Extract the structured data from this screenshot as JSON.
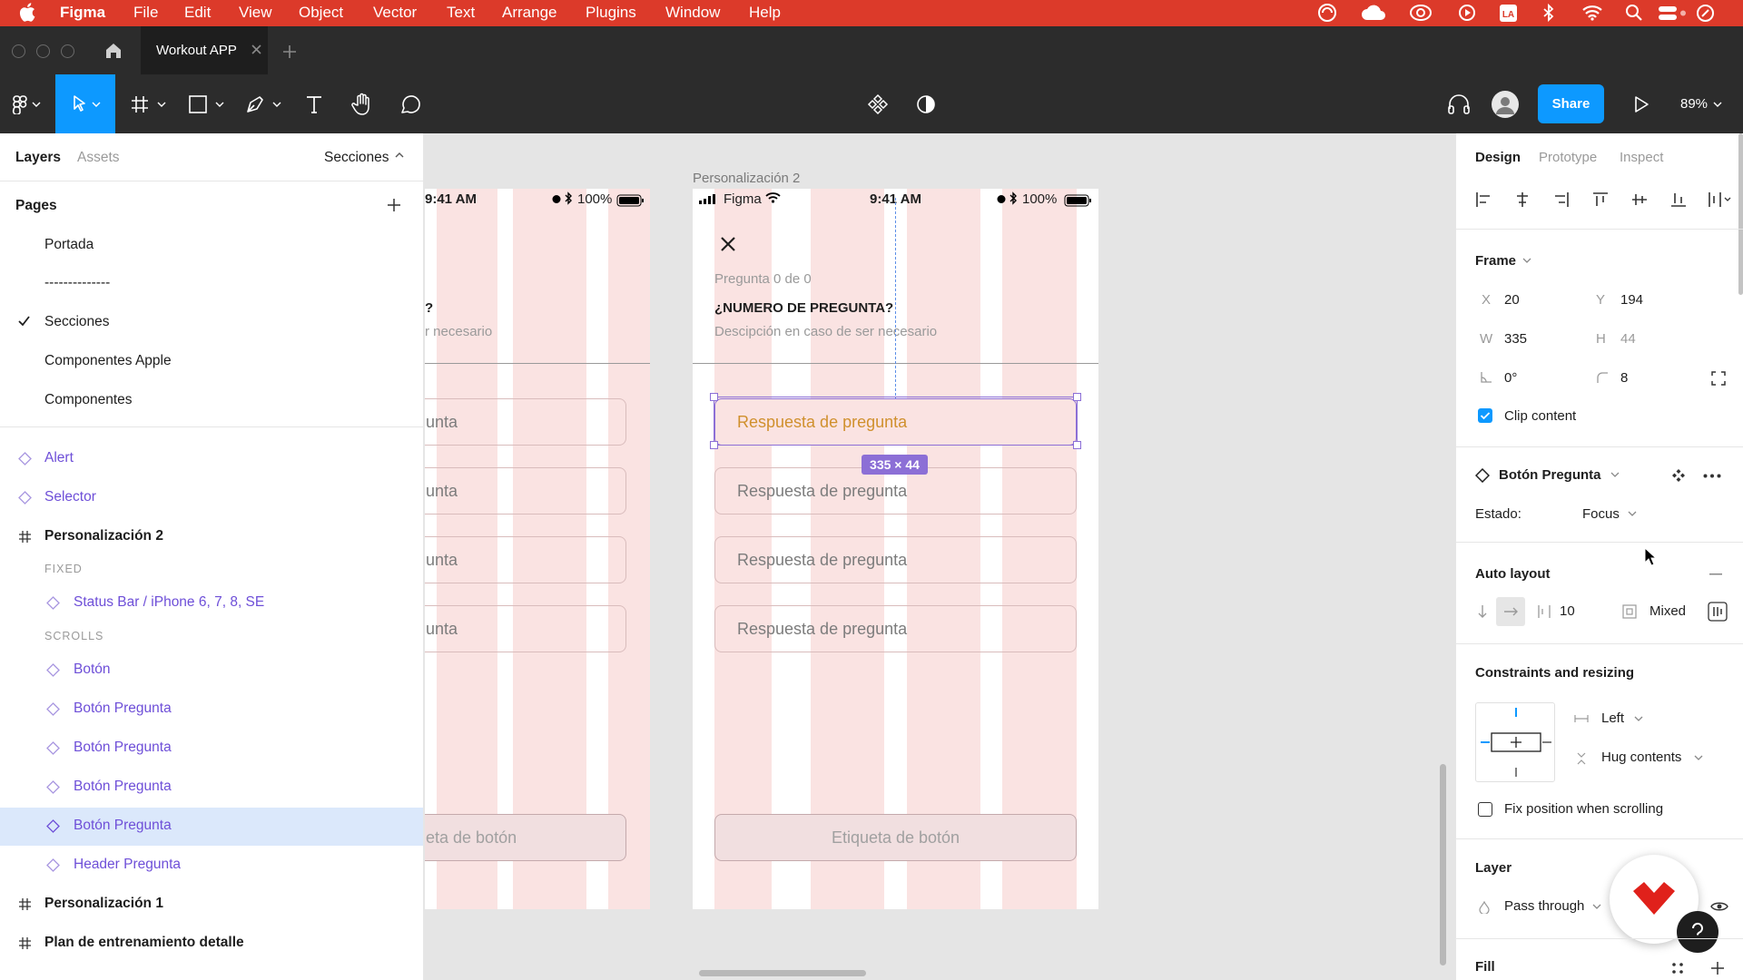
{
  "menubar": {
    "app": "Figma",
    "items": [
      "File",
      "Edit",
      "View",
      "Object",
      "Vector",
      "Text",
      "Arrange",
      "Plugins",
      "Window",
      "Help"
    ]
  },
  "titlebar": {
    "tab_title": "Workout APP"
  },
  "toolbar": {
    "share_label": "Share",
    "zoom": "89%"
  },
  "left_panel": {
    "tabs": [
      "Layers",
      "Assets"
    ],
    "page_selector": "Secciones",
    "pages_heading": "Pages",
    "pages": [
      "Portada",
      "--------------",
      "Secciones",
      "Componentes Apple",
      "Componentes"
    ],
    "current_page": "Secciones",
    "layers": {
      "alert": "Alert",
      "selector": "Selector",
      "frame1": "Personalización 2",
      "fixed_label": "FIXED",
      "status_bar": "Status Bar / iPhone 6, 7, 8, SE",
      "scrolls_label": "SCROLLS",
      "boton": "Botón",
      "bp1": "Botón Pregunta",
      "bp2": "Botón Pregunta",
      "bp3": "Botón Pregunta",
      "bp4": "Botón Pregunta",
      "header": "Header Pregunta",
      "frame2": "Personalización 1",
      "frame3": "Plan de entrenamiento detalle"
    }
  },
  "canvas": {
    "frame_label": "Personalización 2",
    "status": {
      "carrier": "Figma",
      "time": "9:41 AM",
      "battery": "100%"
    },
    "left_frame": {
      "time": "9:41 AM",
      "battery": "100%",
      "q_fragment": "?",
      "desc_fragment": "r necesario",
      "answer_fragment": "unta",
      "button_fragment": "eta de botón"
    },
    "counter": "Pregunta 0 de 0",
    "question": "¿NUMERO DE PREGUNTA?",
    "description": "Descipción en caso de ser necesario",
    "answers": [
      "Respuesta de pregunta",
      "Respuesta de pregunta",
      "Respuesta de pregunta",
      "Respuesta de pregunta"
    ],
    "size_badge": "335 × 44",
    "button_label": "Etiqueta de botón"
  },
  "right_panel": {
    "tabs": [
      "Design",
      "Prototype",
      "Inspect"
    ],
    "frame_heading": "Frame",
    "x_label": "X",
    "x": "20",
    "y_label": "Y",
    "y": "194",
    "w_label": "W",
    "w": "335",
    "h_label": "H",
    "h": "44",
    "rotation": "0°",
    "radius": "8",
    "clip_content": "Clip content",
    "clip_checked": true,
    "component_name": "Botón Pregunta",
    "estado_label": "Estado:",
    "estado_value": "Focus",
    "auto_layout": "Auto layout",
    "spacing": "10",
    "padding": "Mixed",
    "constraints_heading": "Constraints and resizing",
    "horizontal": "Left",
    "vertical": "Hug contents",
    "fix_position": "Fix position when scrolling",
    "layer_heading": "Layer",
    "blend": "Pass through",
    "fill_heading": "Fill"
  },
  "colors": {
    "menubar": "#dc3a2a",
    "accent": "#0d99ff",
    "component": "#6e4fd8",
    "column": "#fae3e2",
    "focus_text": "#d0902d"
  }
}
